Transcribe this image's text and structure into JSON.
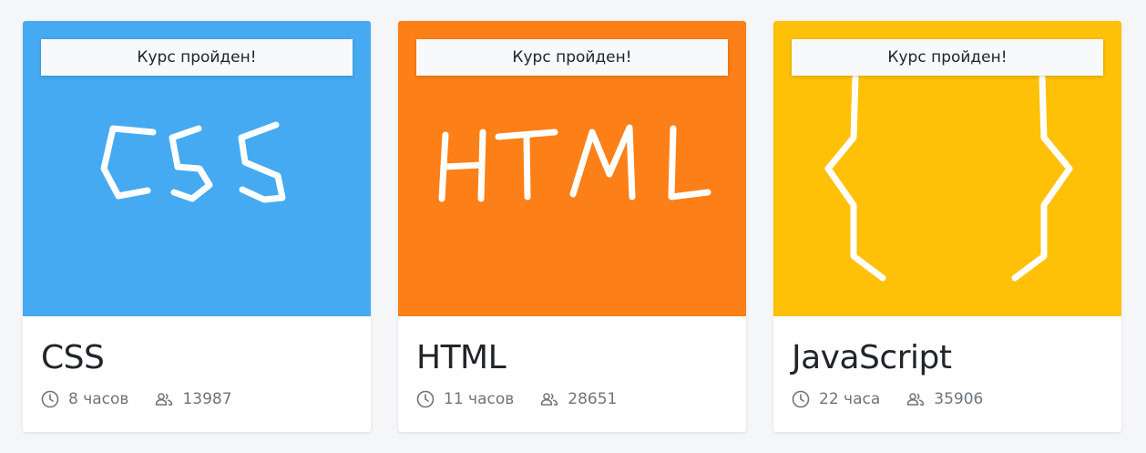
{
  "courses": [
    {
      "badge": "Курс пройден!",
      "title": "CSS",
      "duration": "8 часов",
      "students": "13987",
      "cover_color": "#45aaf2",
      "cover_art": "css-text-art"
    },
    {
      "badge": "Курс пройден!",
      "title": "HTML",
      "duration": "11 часов",
      "students": "28651",
      "cover_color": "#fd7f17",
      "cover_art": "html-text-art"
    },
    {
      "badge": "Курс пройден!",
      "title": "JavaScript",
      "duration": "22 часа",
      "students": "35906",
      "cover_color": "#fec107",
      "cover_art": "curly-braces-art"
    }
  ],
  "icons": {
    "duration": "clock-icon",
    "students": "users-icon"
  },
  "colors": {
    "meta_text": "#6c757d",
    "title_text": "#212529",
    "page_bg": "#f5f6f8"
  }
}
